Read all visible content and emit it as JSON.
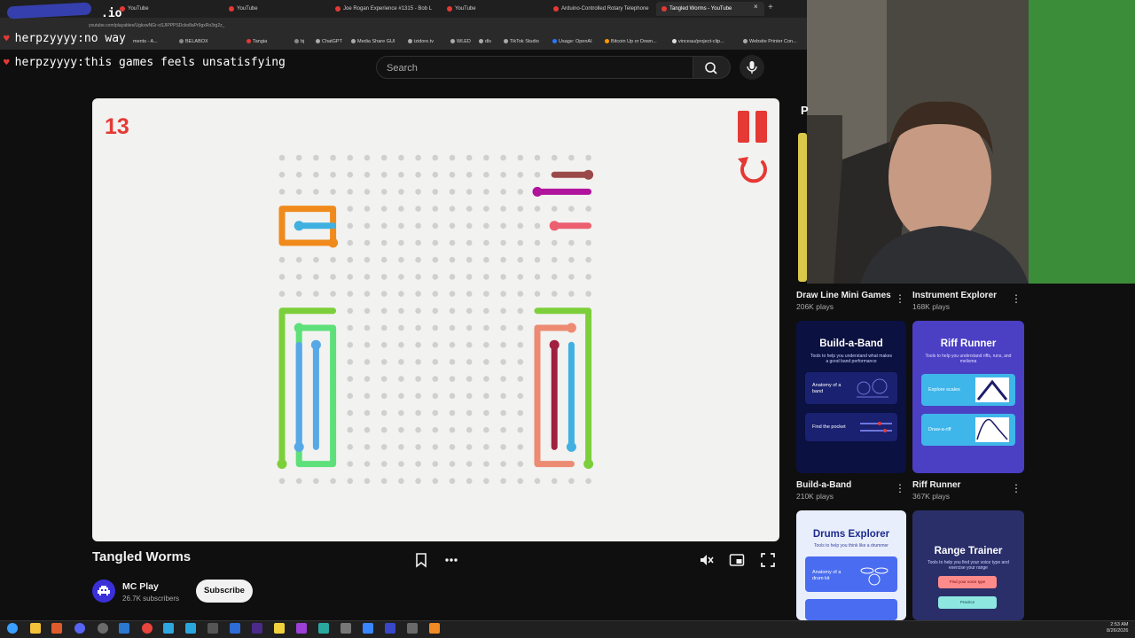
{
  "browser": {
    "tabs": [
      {
        "label": "YouTube"
      },
      {
        "label": "YouTube"
      },
      {
        "label": "Joe Rogan Experience #1315 - Bob L"
      },
      {
        "label": "YouTube"
      },
      {
        "label": "Arduino-Controlled Rotary Telephone"
      },
      {
        "label": "Tangled Worms - YouTube",
        "active": true
      }
    ],
    "new_tab_glyph": "+",
    "close_glyph": "×",
    "url": "youtube.com/playables/UgkxwNGr-oSJIPPPSDcko8aPr9gxRo3rg2z_",
    "bookmarks": [
      "ments - A...",
      "BELABOX",
      "Tangia",
      "bj",
      "ChatGPT",
      "Media Share GUI",
      "izidore.tv",
      "WLED",
      "dls",
      "TikTok Studio",
      "Usage: OpenAI",
      "Bitcoin Up or Down...",
      "vinceau/project-clip...",
      "Website Printer Con..."
    ]
  },
  "chat": {
    "domain_suffix": ".io",
    "messages": [
      {
        "user": "herpzyyyy:",
        "text": "no way"
      },
      {
        "user": "herpzyyyy:",
        "text": "this games feels unsatisfying"
      }
    ]
  },
  "header": {
    "search_placeholder": "Search",
    "search_icon": "search-icon",
    "mic_icon": "mic-icon"
  },
  "game": {
    "score": "13",
    "pause_icon": "pause-icon",
    "restart_icon": "restart-icon",
    "colors": {
      "background": "#f2f2f0",
      "dot": "#d0d0d0",
      "accent": "#e53935"
    }
  },
  "video": {
    "title": "Tangled Worms",
    "channel": "MC Play",
    "subscribers": "26.7K subscribers",
    "subscribe_label": "Subscribe"
  },
  "sidebar": {
    "partial_heading": "P",
    "games": [
      {
        "title": "Draw Line Mini Games",
        "plays": "206K plays"
      },
      {
        "title": "Instrument Explorer",
        "plays": "168K plays"
      },
      {
        "title": "Build-a-Band",
        "plays": "210K plays",
        "card_title": "Build-a-Band",
        "card_sub": "Tools to help you understand what makes a good band performance",
        "card_items": [
          "Anatomy of a band",
          "Find the pocket"
        ]
      },
      {
        "title": "Riff Runner",
        "plays": "367K plays",
        "card_title": "Riff Runner",
        "card_sub": "Tools to help you understand riffs, runs, and melisma",
        "card_items": [
          "Explore scales",
          "Draw-a-riff"
        ]
      },
      {
        "card_title": "Drums Explorer",
        "card_sub": "Tools to help you think like a drummer",
        "card_items": [
          "Anatomy of a drum kit"
        ]
      },
      {
        "card_title": "Range Trainer",
        "card_sub": "Tools to help you find your voice type and exercise your range",
        "card_items": [
          "Find your voice type",
          "Practice"
        ]
      }
    ]
  },
  "taskbar": {
    "time": "2:53 AM",
    "date": "8/26/2026"
  }
}
